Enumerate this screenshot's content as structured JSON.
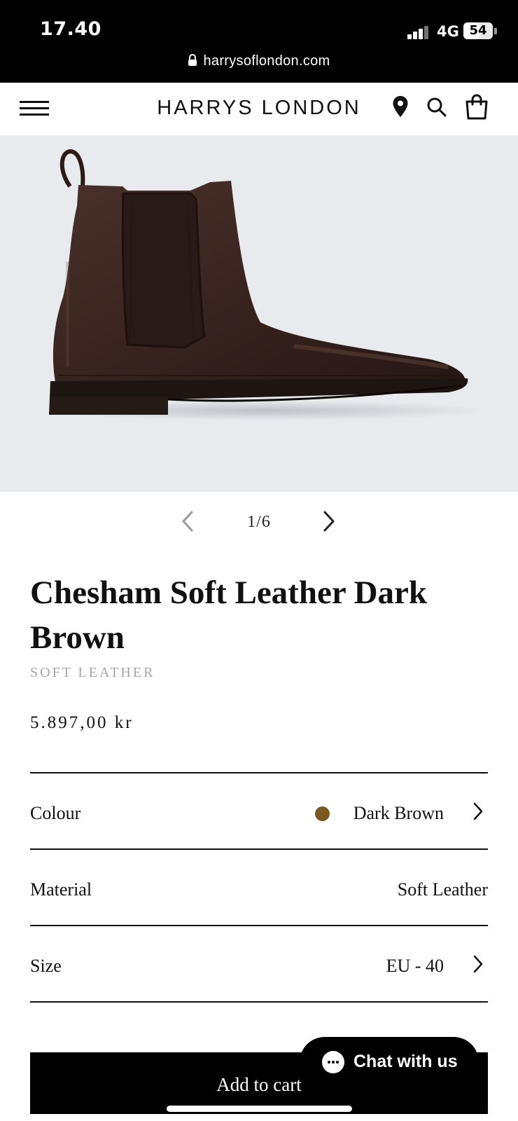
{
  "status_bar": {
    "time": "17.40",
    "network": "4G",
    "battery": "54",
    "battery_level": 0.54,
    "url": "harrysoflondon.com"
  },
  "header": {
    "brand": "HARRYS LONDON",
    "icons": [
      "menu-icon",
      "location-pin-icon",
      "search-icon",
      "shopping-bag-icon"
    ]
  },
  "gallery": {
    "current": 1,
    "total": 6,
    "counter": "1/6",
    "background": "#e8eaed"
  },
  "product": {
    "title": "Chesham Soft Leather Dark Brown",
    "subtitle": "SOFT LEATHER",
    "price": "5.897,00 kr"
  },
  "options": {
    "colour": {
      "label": "Colour",
      "value": "Dark Brown",
      "swatch_color": "#7b5a22"
    },
    "material": {
      "label": "Material",
      "value": "Soft Leather"
    },
    "size": {
      "label": "Size",
      "value": "EU - 40"
    }
  },
  "actions": {
    "add_to_cart": "Add to cart",
    "chat": "Chat with us"
  }
}
